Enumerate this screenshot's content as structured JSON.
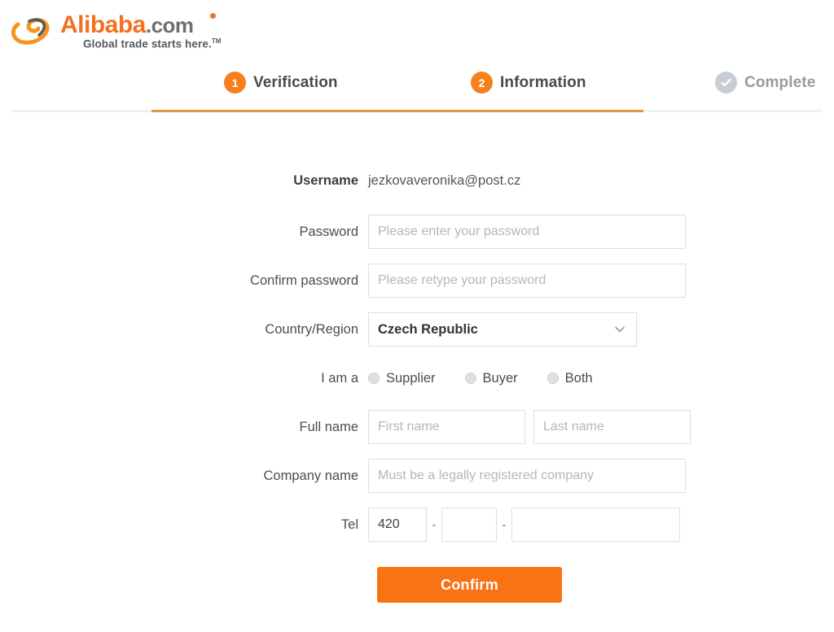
{
  "brand": {
    "name_main": "Alibaba",
    "name_suffix": ".com",
    "tagline": "Global trade starts here.",
    "tm": "TM",
    "accent_color": "#f37021"
  },
  "steps": [
    {
      "number": "1",
      "label": "Verification",
      "state": "active",
      "icon": "number-badge"
    },
    {
      "number": "2",
      "label": "Information",
      "state": "active",
      "icon": "number-badge"
    },
    {
      "number": "",
      "label": "Complete",
      "state": "inactive",
      "icon": "check-circle-icon"
    }
  ],
  "form": {
    "username": {
      "label": "Username",
      "value": "jezkovaveronika@post.cz"
    },
    "password": {
      "label": "Password",
      "placeholder": "Please enter your password",
      "value": ""
    },
    "confirm_password": {
      "label": "Confirm password",
      "placeholder": "Please retype your password",
      "value": ""
    },
    "country": {
      "label": "Country/Region",
      "selected": "Czech Republic",
      "icon": "chevron-down-icon"
    },
    "i_am_a": {
      "label": "I am a",
      "options": [
        {
          "label": "Supplier",
          "selected": false
        },
        {
          "label": "Buyer",
          "selected": false
        },
        {
          "label": "Both",
          "selected": false
        }
      ]
    },
    "full_name": {
      "label": "Full name",
      "first_placeholder": "First name",
      "last_placeholder": "Last name",
      "first_value": "",
      "last_value": ""
    },
    "company_name": {
      "label": "Company name",
      "placeholder": "Must be a legally registered company",
      "value": ""
    },
    "tel": {
      "label": "Tel",
      "country_code": "420",
      "area_code": "",
      "number": "",
      "separator": "-"
    },
    "submit": {
      "label": "Confirm",
      "color": "#f97213"
    }
  }
}
